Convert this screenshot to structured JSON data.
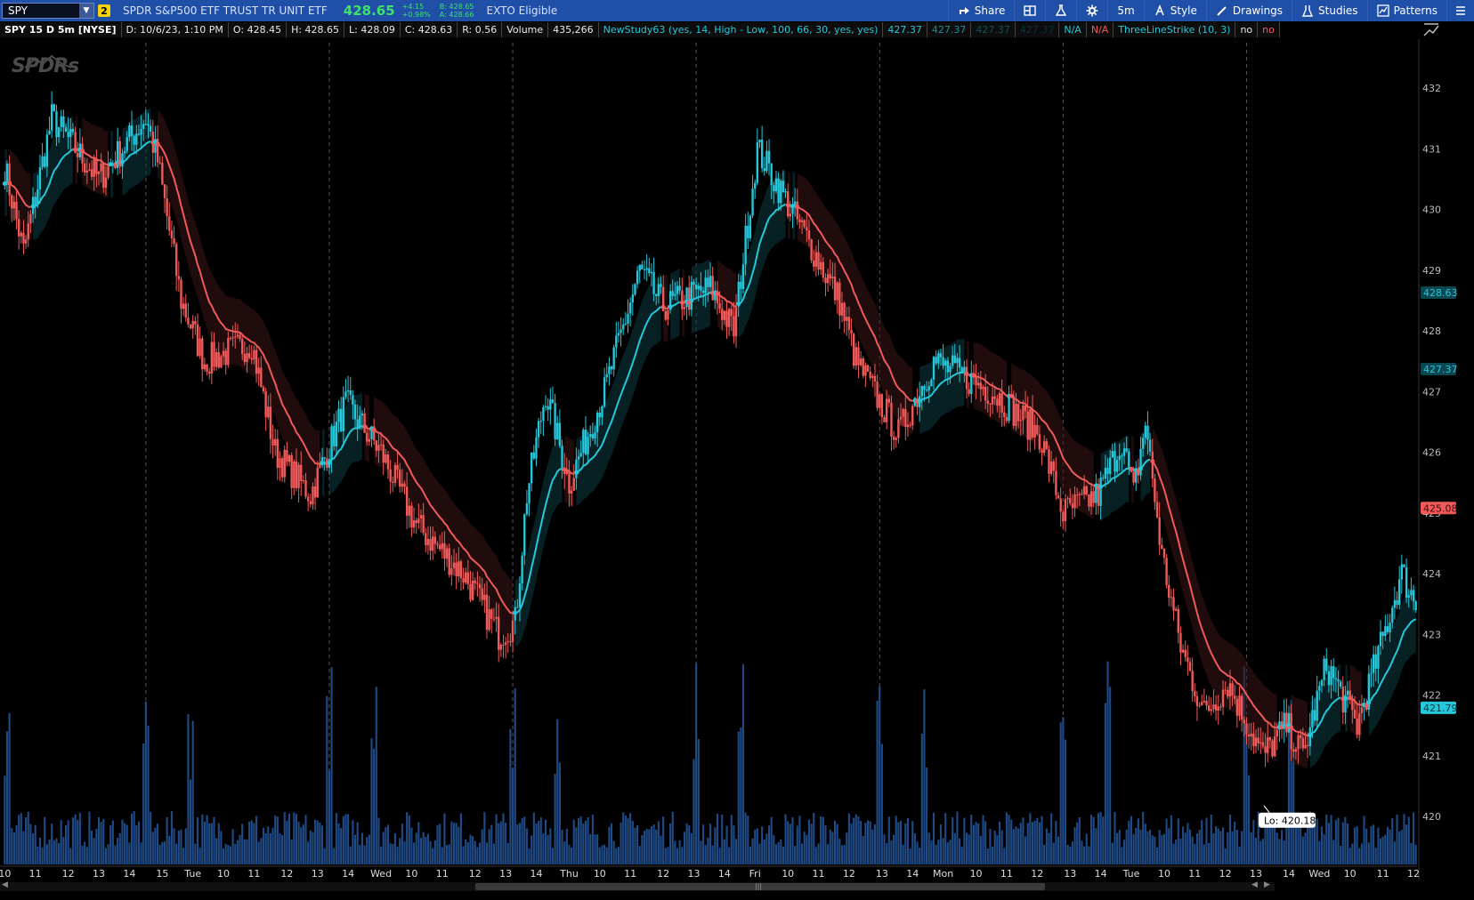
{
  "toolbar": {
    "symbol": "SPY",
    "link_badge": "2",
    "description": "SPDR S&P500 ETF TRUST TR UNIT ETF",
    "last_price": "428.65",
    "change": "+4.15",
    "change_pct": "+0.98%",
    "bid": "B: 428.65",
    "ask": "A: 428.66",
    "exto": "EXTO Eligible",
    "buttons": {
      "share": "Share",
      "timeframe": "5m",
      "style": "Style",
      "drawings": "Drawings",
      "studies": "Studies",
      "patterns": "Patterns"
    }
  },
  "infobar": {
    "title": "SPY 15 D 5m [NYSE]",
    "date": "D: 10/6/23, 1:10 PM",
    "open": "O: 428.45",
    "high": "H: 428.65",
    "low": "L: 428.09",
    "close": "C: 428.63",
    "range": "R: 0.56",
    "volume_label": "Volume",
    "volume_value": "435,266",
    "study1": "NewStudy63 (yes, 14, High - Low, 100, 66, 30, yes, yes)",
    "study1_v1": "427.37",
    "study1_v2": "427.37",
    "study1_v3": "427.37",
    "study1_v4": "427.37",
    "study1_v5": "N/A",
    "study1_v6": "N/A",
    "study2": "ThreeLineStrike (10, 3)",
    "study2_v1": "no",
    "study2_v2": "no"
  },
  "logo_text": "SPDRs",
  "low_marker": "Lo: 420.18",
  "price_badges": {
    "last": "428.63",
    "band": "427.37",
    "red": "425.08",
    "cyan": "421.79"
  },
  "colors": {
    "bull": "#25c7da",
    "bear": "#f05a5a",
    "volume": "#1f4a86",
    "toolbar": "#1f4fa6"
  },
  "chart_data": {
    "type": "candlestick",
    "ylim": [
      419.3,
      432.7
    ],
    "y_ticks": [
      432,
      431,
      430,
      429,
      428,
      427,
      426,
      425,
      424,
      423,
      422,
      421,
      420
    ],
    "x_tick_labels": [
      "10",
      "11",
      "12",
      "13",
      "14",
      "15",
      "Tue",
      "10",
      "11",
      "12",
      "13",
      "14",
      "Wed",
      "10",
      "11",
      "12",
      "13",
      "14",
      "Thu",
      "10",
      "11",
      "12",
      "13",
      "14",
      "Fri",
      "10",
      "11",
      "12",
      "13",
      "14",
      "Mon",
      "10",
      "11",
      "12",
      "13",
      "14",
      "Tue",
      "10",
      "11",
      "12",
      "13",
      "14",
      "Wed",
      "10",
      "11",
      "12"
    ],
    "day_separators": [
      "Tue",
      "Wed",
      "Thu",
      "Fri",
      "Mon",
      "Tue",
      "Wed"
    ],
    "keypoints": [
      [
        0,
        430.7
      ],
      [
        8,
        429.3
      ],
      [
        20,
        431.5
      ],
      [
        40,
        430.5
      ],
      [
        60,
        431.5
      ],
      [
        65,
        430.8
      ],
      [
        75,
        428.5
      ],
      [
        85,
        427.5
      ],
      [
        105,
        427.8
      ],
      [
        115,
        426.0
      ],
      [
        130,
        425.3
      ],
      [
        145,
        426.8
      ],
      [
        160,
        426.0
      ],
      [
        175,
        424.8
      ],
      [
        195,
        424.0
      ],
      [
        210,
        423.0
      ],
      [
        217,
        423.2
      ],
      [
        222,
        425.3
      ],
      [
        230,
        427.0
      ],
      [
        240,
        425.5
      ],
      [
        255,
        427.0
      ],
      [
        270,
        429.0
      ],
      [
        280,
        428.4
      ],
      [
        300,
        428.7
      ],
      [
        310,
        428.0
      ],
      [
        320,
        431.0
      ],
      [
        330,
        430.3
      ],
      [
        340,
        429.6
      ],
      [
        355,
        428.5
      ],
      [
        362,
        427.5
      ],
      [
        380,
        426.3
      ],
      [
        395,
        427.5
      ],
      [
        420,
        427.0
      ],
      [
        440,
        426.3
      ],
      [
        450,
        425.0
      ],
      [
        465,
        425.3
      ],
      [
        475,
        426.2
      ],
      [
        480,
        425.3
      ],
      [
        485,
        426.5
      ],
      [
        492,
        424.3
      ],
      [
        500,
        422.8
      ],
      [
        510,
        421.7
      ],
      [
        520,
        422.2
      ],
      [
        535,
        421.0
      ],
      [
        545,
        421.5
      ],
      [
        552,
        421.0
      ],
      [
        562,
        422.5
      ],
      [
        575,
        421.5
      ],
      [
        585,
        422.8
      ],
      [
        594,
        424.0
      ],
      [
        600,
        423.5
      ]
    ],
    "series": [
      {
        "name": "SPY",
        "candles": 601
      },
      {
        "name": "Volume"
      }
    ]
  }
}
